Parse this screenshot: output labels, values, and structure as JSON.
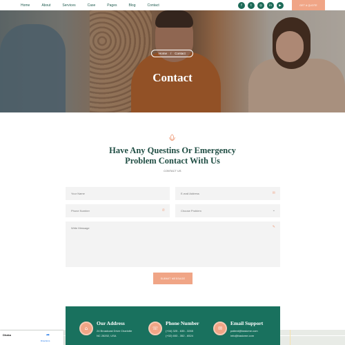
{
  "nav": {
    "links": [
      "Home",
      "About",
      "Services",
      "Case",
      "Pages",
      "Blog",
      "Contact"
    ],
    "social": [
      {
        "icon": "facebook-icon",
        "glyph": "f"
      },
      {
        "icon": "twitter-icon",
        "glyph": "t"
      },
      {
        "icon": "instagram-icon",
        "glyph": "◎"
      },
      {
        "icon": "linkedin-icon",
        "glyph": "in"
      },
      {
        "icon": "youtube-icon",
        "glyph": "▶"
      }
    ],
    "quote_button": "GET A QUOTE"
  },
  "hero": {
    "breadcrumb": {
      "home": "Home",
      "separator": "/",
      "current": "Contact"
    },
    "title": "Contact"
  },
  "section": {
    "icon": "lotus-icon",
    "heading_line1": "Have Any Questins Or Emergency",
    "heading_line2": "Problem Contact With Us",
    "subheading": "CONTACT US"
  },
  "form": {
    "name_placeholder": "Your Name",
    "email_placeholder": "E-mail Address",
    "phone_placeholder": "Phone Number",
    "problem_placeholder": "Choose Problem",
    "message_placeholder": "Write Message",
    "submit_label": "SUBMIT MESSAGE"
  },
  "map": {
    "city": "Dhaka",
    "directions_label": "Directions"
  },
  "contact": {
    "address_title": "Our Address",
    "address_line1": "24 Broadcast Drive Charlotte",
    "address_line2": "NC 28202, USA",
    "phone_title": "Phone Number",
    "phone_line1": "(+04) 325 - 635 - 3265",
    "phone_line2": "(+02) 653 - 352 - 6524",
    "email_title": "Email Support",
    "email_line1": "patient@basicme.com",
    "email_line2": "info@basicme.com"
  },
  "colors": {
    "accent": "#f0a586",
    "brand_green": "#19715e",
    "heading": "#1f4d43"
  }
}
